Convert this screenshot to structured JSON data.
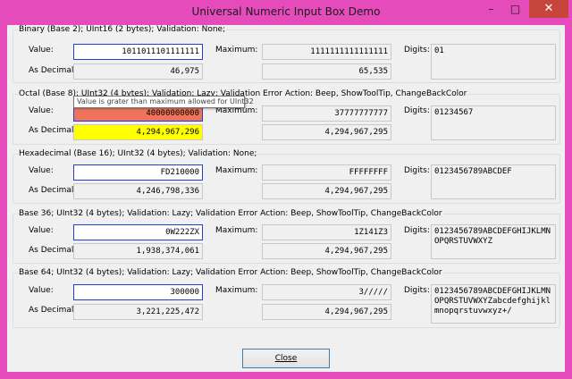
{
  "window": {
    "title": "Universal Numeric Input Box Demo",
    "minimize_glyph": "–",
    "maximize_glyph": "□",
    "close_glyph": "✕"
  },
  "labels": {
    "value": "Value:",
    "as_decimal": "As Decimal:",
    "maximum": "Maximum:",
    "digits": "Digits:"
  },
  "groups": [
    {
      "title": "Binary (Base 2); UInt16 (2 bytes); Validation: None;",
      "value": "1011011101111111",
      "as_decimal": "46,975",
      "maximum": "1111111111111111",
      "max_decimal": "65,535",
      "digits": "01"
    },
    {
      "title": "Octal (Base 8); UInt32 (4 bytes); Validation: Lazy; Validation Error Action: Beep, ShowToolTip, ChangeBackColor",
      "value": "40000000000",
      "as_decimal": "4,294,967,296",
      "maximum": "37777777777",
      "max_decimal": "4,294,967,295",
      "digits": "01234567",
      "tooltip": "Value is grater than maximum allowed for UInt32"
    },
    {
      "title": "Hexadecimal (Base 16); UInt32 (4 bytes); Validation: None;",
      "value": "FD210000",
      "as_decimal": "4,246,798,336",
      "maximum": "FFFFFFFF",
      "max_decimal": "4,294,967,295",
      "digits": "0123456789ABCDEF"
    },
    {
      "title": "Base 36; UInt32 (4 bytes); Validation: Lazy; Validation Error Action: Beep, ShowToolTip, ChangeBackColor",
      "value": "0W222ZX",
      "as_decimal": "1,938,374,061",
      "maximum": "1Z141Z3",
      "max_decimal": "4,294,967,295",
      "digits": "0123456789ABCDEFGHIJKLMNOPQRSTUVWXYZ"
    },
    {
      "title": "Base 64; UInt32 (4 bytes); Validation: Lazy; Validation Error Action: Beep, ShowToolTip, ChangeBackColor",
      "value": "300000",
      "as_decimal": "3,221,225,472",
      "maximum": "3/////",
      "max_decimal": "4,294,967,295",
      "digits": "0123456789ABCDEFGHIJKLMNOPQRSTUVWXYZabcdefghijklmnopqrstuvwxyz+/"
    }
  ],
  "footer": {
    "close_label": "Close"
  },
  "colors": {
    "titlebar": "#e54bba",
    "close_button": "#c7463b",
    "input_border": "#1e3fd0",
    "error_value_bg": "#f0735a",
    "error_decimal_bg": "#ffff00"
  }
}
